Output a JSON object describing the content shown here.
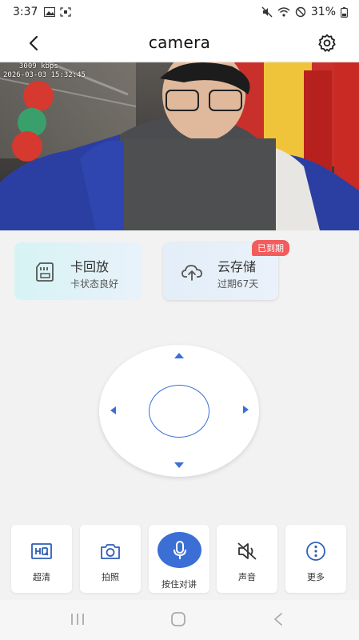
{
  "status_bar": {
    "time": "3:37",
    "battery": "31%"
  },
  "nav": {
    "title": "camera"
  },
  "video": {
    "bitrate": "3009 kbps",
    "timestamp": "2026-03-03 15:32:45"
  },
  "cards": {
    "playback": {
      "title": "卡回放",
      "subtitle": "卡状态良好"
    },
    "cloud": {
      "title": "云存储",
      "subtitle": "过期67天",
      "badge": "已到期"
    }
  },
  "actions": [
    {
      "label": "超清",
      "icon": "hd-icon"
    },
    {
      "label": "拍照",
      "icon": "camera-icon"
    },
    {
      "label": "按住对讲",
      "icon": "microphone-icon"
    },
    {
      "label": "声音",
      "icon": "speaker-muted-icon"
    },
    {
      "label": "更多",
      "icon": "more-icon"
    }
  ],
  "colors": {
    "accent": "#3b6fd6",
    "badge": "#f25c5c"
  }
}
